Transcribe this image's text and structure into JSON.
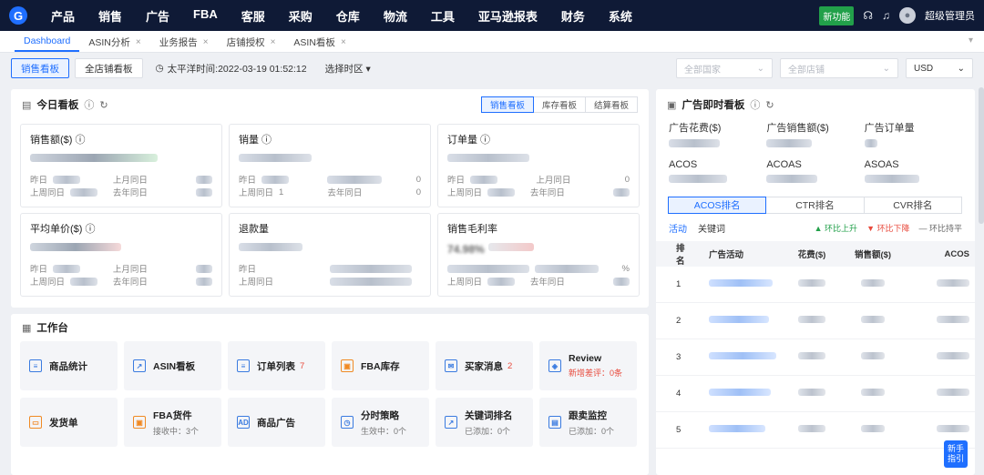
{
  "topbar": {
    "logo_letter": "G",
    "nav": [
      "产品",
      "销售",
      "广告",
      "FBA",
      "客服",
      "采购",
      "仓库",
      "物流",
      "工具",
      "亚马逊报表",
      "财务",
      "系统"
    ],
    "new_feature": "新功能",
    "username": "超级管理员"
  },
  "tabs": [
    {
      "label": "Dashboard",
      "active": true
    },
    {
      "label": "ASIN分析",
      "close": "×"
    },
    {
      "label": "业务报告",
      "close": "×"
    },
    {
      "label": "店铺授权",
      "close": "×"
    },
    {
      "label": "ASIN看板",
      "close": "×"
    }
  ],
  "toolbar": {
    "views": [
      "销售看板",
      "全店铺看板"
    ],
    "time_label": "太平洋时间:2022-03-19 01:52:12",
    "zone_select": "选择时区 ▾",
    "filter_country_placeholder": "全部国家",
    "filter_store_placeholder": "全部店铺",
    "currency": "USD"
  },
  "today": {
    "title": "今日看板",
    "subtabs": [
      "销售看板",
      "库存看板",
      "结算看板"
    ],
    "metrics": [
      {
        "label": "销售额($)",
        "rows": [
          [
            "昨日",
            "上月同日"
          ],
          [
            "上周同日",
            "去年同日"
          ]
        ]
      },
      {
        "label": "销量",
        "rows": [
          [
            "昨日",
            "0"
          ],
          [
            "上周同日",
            "去年同日"
          ]
        ],
        "side": [
          "1",
          "0"
        ]
      },
      {
        "label": "订单量",
        "rows": [
          [
            "昨日",
            "上月同日"
          ],
          [
            "上周同日",
            "去年同日"
          ]
        ],
        "side": [
          "0",
          ""
        ]
      },
      {
        "label": "平均单价($)",
        "rows": [
          [
            "昨日",
            "上月同日"
          ],
          [
            "上周同日",
            "去年同日"
          ]
        ]
      },
      {
        "label": "退款量",
        "rows": [
          [
            "昨日",
            ""
          ],
          [
            "上周同日",
            ""
          ]
        ]
      },
      {
        "label": "销售毛利率",
        "value_hint": "74.98%",
        "rows": [
          [
            "上周同日",
            "去年同日"
          ]
        ],
        "pct": "%"
      }
    ]
  },
  "work": {
    "title": "工作台",
    "items": [
      {
        "label": "商品统计",
        "icon": "doc-icon"
      },
      {
        "label": "ASIN看板",
        "icon": "chart-icon"
      },
      {
        "label": "订单列表",
        "badge": "7",
        "icon": "list-icon"
      },
      {
        "label": "FBA库存",
        "icon": "box-icon"
      },
      {
        "label": "买家消息",
        "badge": "2",
        "icon": "mail-icon"
      },
      {
        "label": "Review",
        "sub": "新增差评：0条",
        "icon": "cube-icon"
      },
      {
        "label": "发货单",
        "icon": "truck-icon"
      },
      {
        "label": "FBA货件",
        "sub": "接收中：3个",
        "icon": "package-icon"
      },
      {
        "label": "商品广告",
        "icon": "ad-icon"
      },
      {
        "label": "分时策略",
        "sub": "生效中：0个",
        "icon": "clock-icon"
      },
      {
        "label": "关键词排名",
        "sub": "已添加：0个",
        "icon": "rank-icon"
      },
      {
        "label": "跟卖监控",
        "sub": "已添加：0个",
        "icon": "monitor-icon"
      }
    ]
  },
  "ad": {
    "title": "广告即时看板",
    "metrics": [
      "广告花费($)",
      "广告销售额($)",
      "广告订单量",
      "ACOS",
      "ACOAS",
      "ASOAS"
    ],
    "rank_tabs": [
      "ACOS排名",
      "CTR排名",
      "CVR排名"
    ],
    "filter_tabs": [
      "活动",
      "关键词"
    ],
    "legend": {
      "up": "▲ 环比上升",
      "down": "▼ 环比下降",
      "flat": "— 环比持平"
    },
    "columns": [
      "排名",
      "广告活动",
      "花费($)",
      "销售额($)",
      "ACOS"
    ],
    "rows": [
      "1",
      "2",
      "3",
      "4",
      "5"
    ]
  },
  "newhand": "新手指引"
}
